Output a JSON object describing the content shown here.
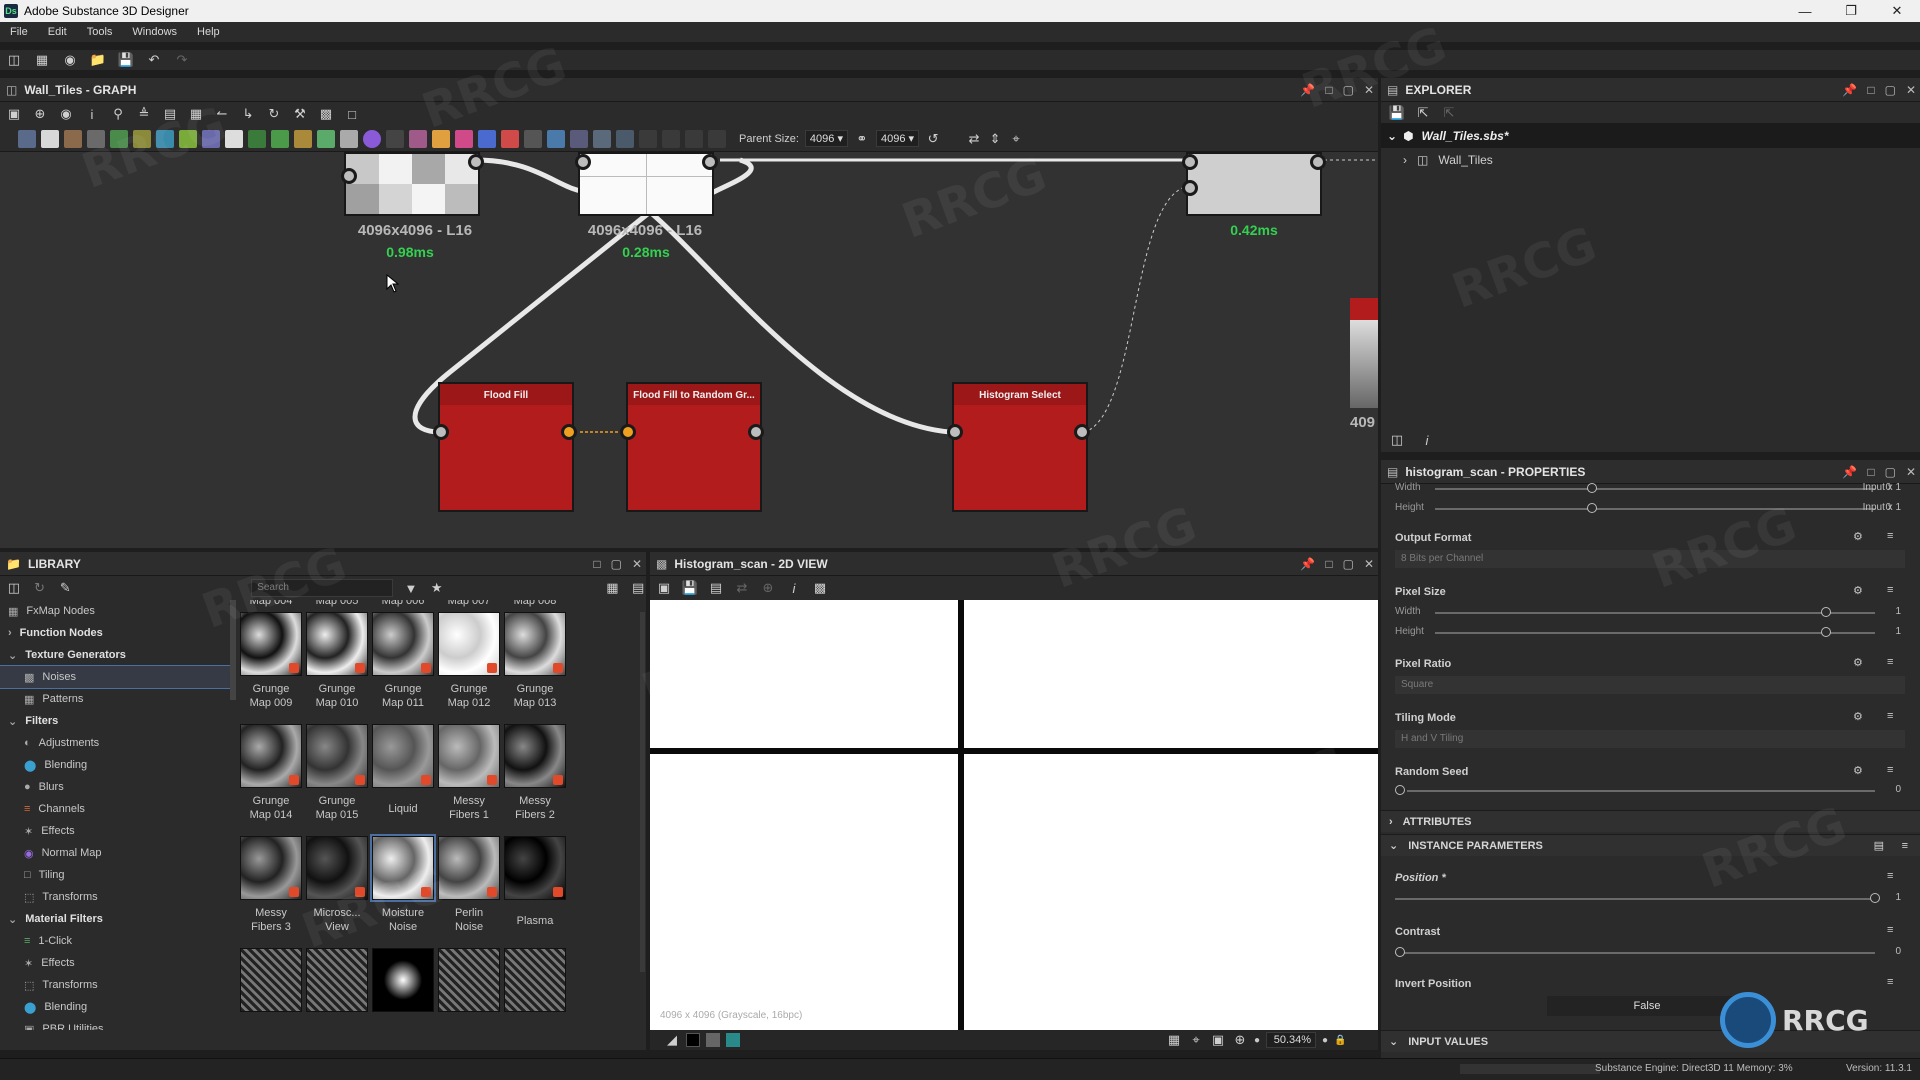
{
  "window": {
    "title": "Adobe Substance 3D Designer",
    "app_icon": "Ds"
  },
  "menu": [
    "File",
    "Edit",
    "Tools",
    "Windows",
    "Help"
  ],
  "graph": {
    "title": "Wall_Tiles - GRAPH",
    "parent_size_label": "Parent Size:",
    "parent_size_value": "4096",
    "output_size_value": "4096",
    "nodes": [
      {
        "label": "4096x4096 - L16",
        "time": "0.98ms"
      },
      {
        "label": "4096x4096 - L16",
        "time": "0.28ms"
      },
      {
        "label": "",
        "time": "0.42ms"
      }
    ],
    "red_nodes": [
      "Flood Fill",
      "Flood Fill to Random Gr...",
      "Histogram Select"
    ],
    "partial_label": "409"
  },
  "explorer": {
    "title": "EXPLORER",
    "package": "Wall_Tiles.sbs*",
    "graph_item": "Wall_Tiles"
  },
  "properties": {
    "title": "histogram_scan - PROPERTIES",
    "partial_rows": [
      {
        "label": "Width",
        "value": "0",
        "extra": "Input x 1"
      },
      {
        "label": "Height",
        "value": "0",
        "extra": "Input x 1"
      }
    ],
    "output_format": {
      "label": "Output Format",
      "value": "8 Bits per Channel"
    },
    "pixel_size": {
      "label": "Pixel Size",
      "width_label": "Width",
      "width_value": "1",
      "height_label": "Height",
      "height_value": "1"
    },
    "pixel_ratio": {
      "label": "Pixel Ratio",
      "value": "Square"
    },
    "tiling_mode": {
      "label": "Tiling Mode",
      "value": "H and V Tiling"
    },
    "random_seed": {
      "label": "Random Seed",
      "value": "0"
    },
    "attributes_label": "ATTRIBUTES",
    "instance_params_label": "INSTANCE PARAMETERS",
    "position": {
      "label": "Position *",
      "value": "1",
      "level": 1.0
    },
    "contrast": {
      "label": "Contrast",
      "value": "0",
      "level": 0.0
    },
    "invert_position": {
      "label": "Invert Position",
      "value": "False"
    },
    "input_values_label": "INPUT VALUES"
  },
  "library": {
    "title": "LIBRARY",
    "search_placeholder": "Search",
    "tree": [
      {
        "label": "FxMap Nodes",
        "bold": false,
        "indent": 0,
        "icon": "fxmap-icon"
      },
      {
        "label": "Function Nodes",
        "bold": true,
        "indent": 0,
        "icon": "chevron-right-icon"
      },
      {
        "label": "Texture Generators",
        "bold": true,
        "indent": 0,
        "icon": "chevron-down-icon"
      },
      {
        "label": "Noises",
        "bold": false,
        "indent": 1,
        "icon": "noise-icon",
        "selected": true
      },
      {
        "label": "Patterns",
        "bold": false,
        "indent": 1,
        "icon": "pattern-icon"
      },
      {
        "label": "Filters",
        "bold": true,
        "indent": 0,
        "icon": "chevron-down-icon"
      },
      {
        "label": "Adjustments",
        "bold": false,
        "indent": 1,
        "icon": "adjust-icon"
      },
      {
        "label": "Blending",
        "bold": false,
        "indent": 1,
        "icon": "blend-icon"
      },
      {
        "label": "Blurs",
        "bold": false,
        "indent": 1,
        "icon": "blur-icon"
      },
      {
        "label": "Channels",
        "bold": false,
        "indent": 1,
        "icon": "channels-icon"
      },
      {
        "label": "Effects",
        "bold": false,
        "indent": 1,
        "icon": "effects-icon"
      },
      {
        "label": "Normal Map",
        "bold": false,
        "indent": 1,
        "icon": "normal-map-icon"
      },
      {
        "label": "Tiling",
        "bold": false,
        "indent": 1,
        "icon": "tiling-icon"
      },
      {
        "label": "Transforms",
        "bold": false,
        "indent": 1,
        "icon": "transforms-icon"
      },
      {
        "label": "Material Filters",
        "bold": true,
        "indent": 0,
        "icon": "chevron-down-icon"
      },
      {
        "label": "1-Click",
        "bold": false,
        "indent": 1,
        "icon": "oneclick-icon"
      },
      {
        "label": "Effects",
        "bold": false,
        "indent": 1,
        "icon": "effects-icon"
      },
      {
        "label": "Transforms",
        "bold": false,
        "indent": 1,
        "icon": "transforms-icon"
      },
      {
        "label": "Blending",
        "bold": false,
        "indent": 1,
        "icon": "blend-icon"
      },
      {
        "label": "PBR Utilities",
        "bold": false,
        "indent": 1,
        "icon": "pbr-icon"
      }
    ],
    "top_partial_labels": [
      "Map 004",
      "Map 005",
      "Map 006",
      "Map 007",
      "Map 008"
    ],
    "items": [
      {
        "l1": "Grunge",
        "l2": "Map 009"
      },
      {
        "l1": "Grunge",
        "l2": "Map 010"
      },
      {
        "l1": "Grunge",
        "l2": "Map 011"
      },
      {
        "l1": "Grunge",
        "l2": "Map 012"
      },
      {
        "l1": "Grunge",
        "l2": "Map 013"
      },
      {
        "l1": "Grunge",
        "l2": "Map 014"
      },
      {
        "l1": "Grunge",
        "l2": "Map 015"
      },
      {
        "l1": "Liquid",
        "l2": ""
      },
      {
        "l1": "Messy",
        "l2": "Fibers 1"
      },
      {
        "l1": "Messy",
        "l2": "Fibers 2"
      },
      {
        "l1": "Messy",
        "l2": "Fibers 3"
      },
      {
        "l1": "Microsc...",
        "l2": "View"
      },
      {
        "l1": "Moisture",
        "l2": "Noise"
      },
      {
        "l1": "Perlin",
        "l2": "Noise"
      },
      {
        "l1": "Plasma",
        "l2": ""
      }
    ]
  },
  "view2d": {
    "title": "Histogram_scan - 2D VIEW",
    "image_info": "4096 x 4096 (Grayscale, 16bpc)",
    "zoom": "50.34%"
  },
  "status": {
    "engine": "Substance Engine: Direct3D 11  Memory: 3%",
    "version": "Version: 11.3.1"
  },
  "colors": {
    "accent_green": "#34d050",
    "node_red": "#b31c1c",
    "port_orange": "#f0a020"
  }
}
